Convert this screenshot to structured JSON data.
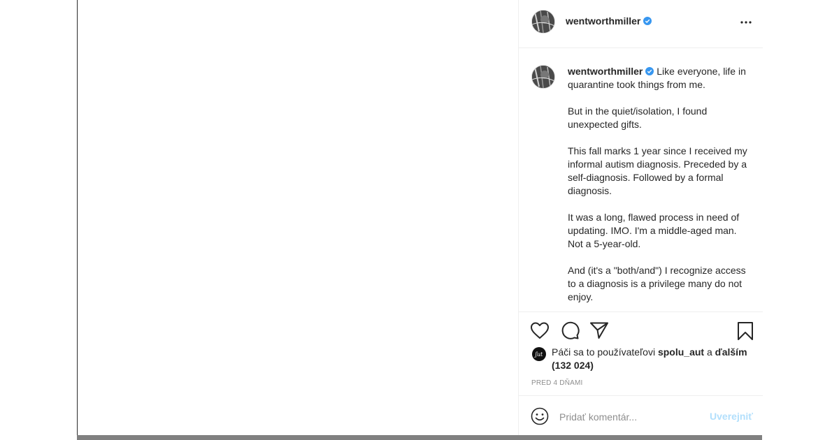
{
  "post": {
    "username": "wentworthmiller",
    "caption": "Like everyone, life in quarantine took things from me.\n\nBut in the quiet/isolation, I found unexpected gifts.\n\nThis fall marks 1 year since I received my informal autism diagnosis. Preceded by a self-diagnosis. Followed by a formal diagnosis.\n\nIt was a long, flawed process in need of updating. IMO. I'm a middle-aged man. Not a 5-year-old.\n\nAnd (it's a \"both/and\") I recognize access to a diagnosis is a privilege many do not enjoy.",
    "likes_prefix": "Páči sa to používateľovi",
    "likes_user": "spolu_aut",
    "likes_and": "a",
    "likes_others": "ďalším (132 024)",
    "timestamp": "PRED 4 DŇAMI"
  },
  "comment": {
    "placeholder": "Pridať komentár...",
    "post_label": "Uverejniť"
  },
  "icons": {
    "verified": "verified-badge-icon",
    "more": "more-options-icon",
    "like": "heart-icon",
    "comment": "comment-bubble-icon",
    "share": "paper-plane-icon",
    "save": "bookmark-icon",
    "emoji": "smiley-face-icon"
  },
  "colors": {
    "verified": "#3897f0",
    "post_button_disabled": "#b2dffc",
    "muted_text": "#8e8e8e"
  }
}
